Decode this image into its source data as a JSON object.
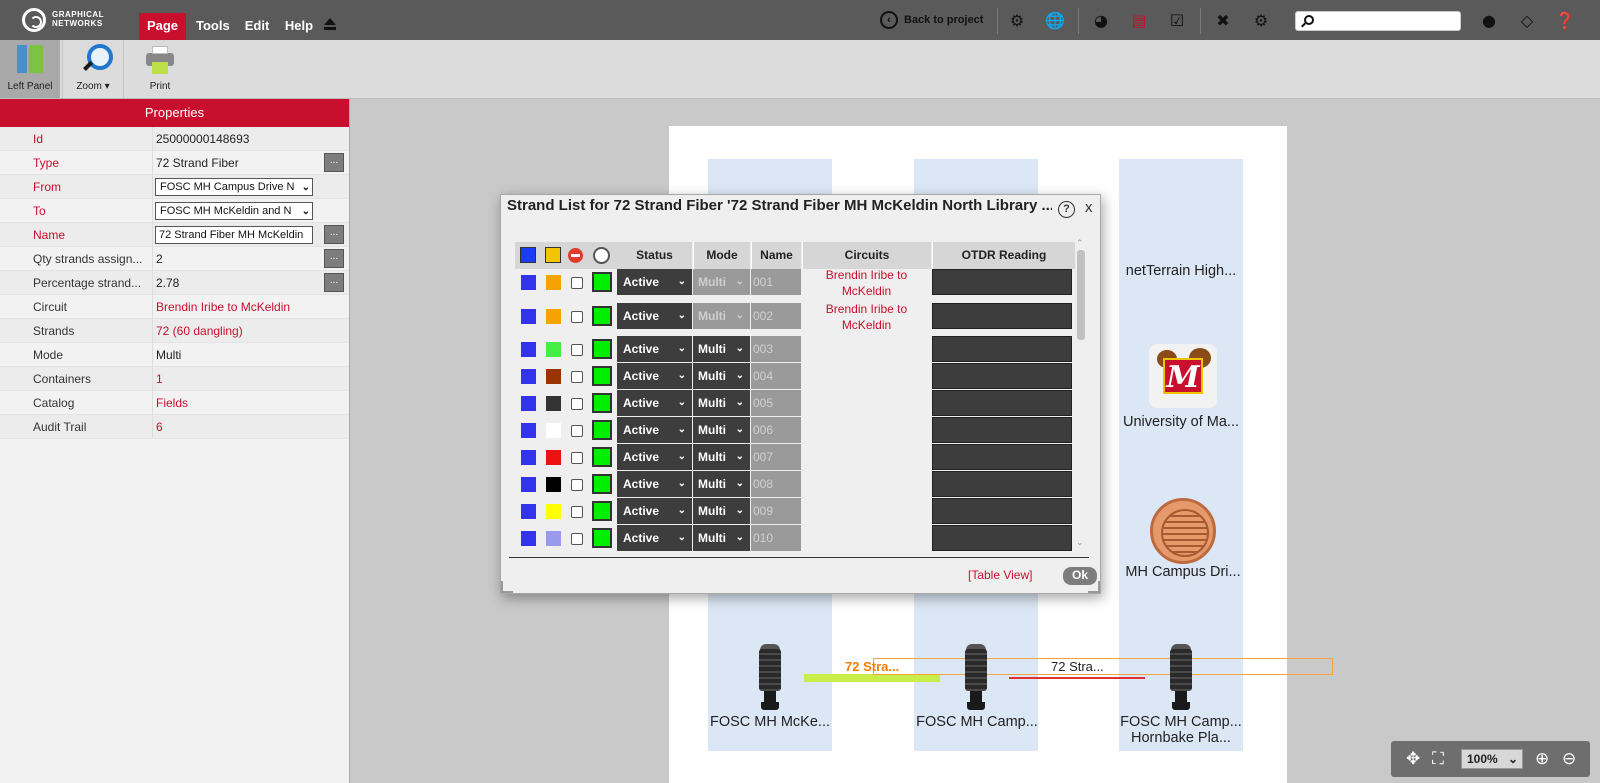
{
  "brand": {
    "line1": "GRAPHICAL",
    "line2": "NETWORKS"
  },
  "menu": {
    "page": "Page",
    "tools": "Tools",
    "edit": "Edit",
    "help": "Help"
  },
  "toolbar": {
    "back_label": "Back to project"
  },
  "search": {
    "value": ""
  },
  "ribbon": {
    "left_panel": "Left Panel",
    "zoom": "Zoom ▾",
    "print": "Print"
  },
  "properties": {
    "title": "Properties",
    "rows": [
      {
        "key": "Id",
        "value": "25000000148693"
      },
      {
        "key": "Type",
        "value": "72 Strand Fiber"
      },
      {
        "key": "From",
        "value": "FOSC MH Campus Drive N"
      },
      {
        "key": "To",
        "value": "FOSC MH McKeldin and N"
      },
      {
        "key": "Name",
        "value": "72 Strand Fiber MH McKeldin"
      },
      {
        "key": "Qty strands assign...",
        "value": "2"
      },
      {
        "key": "Percentage strand...",
        "value": "2.78"
      },
      {
        "key": "Circuit",
        "value": "Brendin Iribe to McKeldin"
      },
      {
        "key": "Strands",
        "value": "72 (60 dangling)"
      },
      {
        "key": "Mode",
        "value": "Multi"
      },
      {
        "key": "Containers",
        "value": "1"
      },
      {
        "key": "Catalog",
        "value": "Fields"
      },
      {
        "key": "Audit Trail",
        "value": "6"
      }
    ],
    "btn": "..."
  },
  "canvas": {
    "nodes": {
      "netterrain": "netTerrain High...",
      "umd": "University of Ma...",
      "mh_campus": "MH Campus Dri...",
      "fosc_mck": "FOSC MH McKe...",
      "fosc_camp": "FOSC MH Camp...",
      "fosc_camp2_l1": "FOSC MH Camp...",
      "fosc_camp2_l2": "Hornbake Pla..."
    },
    "cables": {
      "c1": "72 Stra...",
      "c2": "72 Stra..."
    }
  },
  "dialog": {
    "title": "Strand List for 72 Strand Fiber '72 Strand Fiber MH McKeldin North Library ...",
    "close": "x",
    "help": "?",
    "headers": {
      "status": "Status",
      "mode": "Mode",
      "name": "Name",
      "circuits": "Circuits",
      "otdr": "OTDR Reading"
    },
    "rows": [
      {
        "color": "#f5a300",
        "status": "Active",
        "mode": "Multi",
        "name": "001",
        "circuit": "Brendin Iribe to McKeldin",
        "mode_disabled": true
      },
      {
        "color": "#f5a300",
        "status": "Active",
        "mode": "Multi",
        "name": "002",
        "circuit": "Brendin Iribe to McKeldin",
        "mode_disabled": true
      },
      {
        "color": "#44ee44",
        "status": "Active",
        "mode": "Multi",
        "name": "003",
        "circuit": "",
        "mode_disabled": false
      },
      {
        "color": "#993300",
        "status": "Active",
        "mode": "Multi",
        "name": "004",
        "circuit": "",
        "mode_disabled": false
      },
      {
        "color": "#333333",
        "status": "Active",
        "mode": "Multi",
        "name": "005",
        "circuit": "",
        "mode_disabled": false
      },
      {
        "color": "#ffffff",
        "status": "Active",
        "mode": "Multi",
        "name": "006",
        "circuit": "",
        "mode_disabled": false
      },
      {
        "color": "#ee1111",
        "status": "Active",
        "mode": "Multi",
        "name": "007",
        "circuit": "",
        "mode_disabled": false
      },
      {
        "color": "#000000",
        "status": "Active",
        "mode": "Multi",
        "name": "008",
        "circuit": "",
        "mode_disabled": false
      },
      {
        "color": "#ffff00",
        "status": "Active",
        "mode": "Multi",
        "name": "009",
        "circuit": "",
        "mode_disabled": false
      },
      {
        "color": "#9999ee",
        "status": "Active",
        "mode": "Multi",
        "name": "010",
        "circuit": "",
        "mode_disabled": false
      }
    ],
    "table_view": "[Table View]",
    "ok": "Ok"
  },
  "zoomctl": {
    "level": "100%"
  },
  "colors": {
    "accent": "#c8102e",
    "topbar": "#5a5a5a",
    "strand_blue": "#3333ee",
    "green": "#00ee00"
  }
}
